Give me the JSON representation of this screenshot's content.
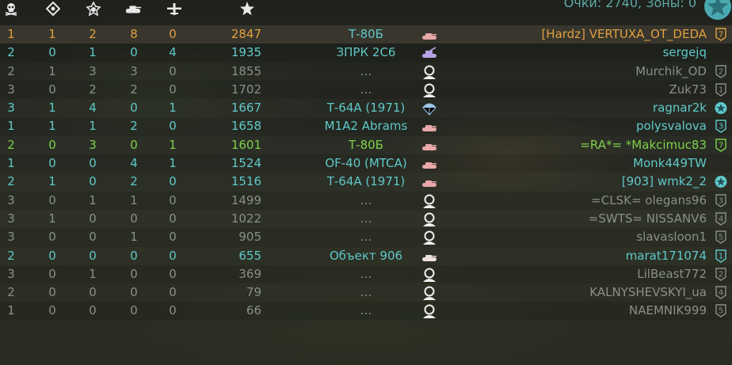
{
  "header": {
    "icons": [
      "skull-icon",
      "target-icon",
      "medal-icon",
      "tank-icon",
      "plane-icon",
      "star-icon"
    ],
    "score_text": "Очки: 2740, Зоны: 0"
  },
  "colors": {
    "teal": "#5fc9c9",
    "gray": "#8a8f88",
    "green": "#7ed04a",
    "orange": "#e0a040",
    "highlight_row": "#3c3a30"
  },
  "rows": [
    {
      "deaths": "1",
      "c2": "1",
      "c3": "2",
      "c4": "8",
      "c5": "0",
      "points": "2847",
      "vehicle": "Т-80Б",
      "vicon": "tank",
      "name": "[Hardz] VERTUXA_OT_DEDA",
      "rank": "7",
      "style": "orange",
      "highlight": true
    },
    {
      "deaths": "2",
      "c2": "0",
      "c3": "1",
      "c4": "0",
      "c5": "4",
      "points": "1935",
      "vehicle": "ЗПРК 2С6",
      "vicon": "spaa",
      "name": "sergejq",
      "rank": "",
      "style": "teal"
    },
    {
      "deaths": "2",
      "c2": "1",
      "c3": "3",
      "c4": "3",
      "c5": "0",
      "points": "1855",
      "vehicle": "...",
      "vicon": "dead",
      "name": "Murchik_OD",
      "rank": "2",
      "style": "gray"
    },
    {
      "deaths": "3",
      "c2": "0",
      "c3": "2",
      "c4": "2",
      "c5": "0",
      "points": "1702",
      "vehicle": "...",
      "vicon": "dead",
      "name": "Zuk73",
      "rank": "1",
      "style": "gray"
    },
    {
      "deaths": "3",
      "c2": "1",
      "c3": "4",
      "c4": "0",
      "c5": "1",
      "points": "1667",
      "vehicle": "Т-64А (1971)",
      "vicon": "parachute",
      "name": "ragnar2k",
      "rank": "star",
      "style": "teal"
    },
    {
      "deaths": "1",
      "c2": "1",
      "c3": "1",
      "c4": "2",
      "c5": "0",
      "points": "1658",
      "vehicle": "M1A2 Abrams",
      "vicon": "tank",
      "name": "polysvalova",
      "rank": "3",
      "style": "teal"
    },
    {
      "deaths": "2",
      "c2": "0",
      "c3": "3",
      "c4": "0",
      "c5": "1",
      "points": "1601",
      "vehicle": "Т-80Б",
      "vicon": "tank",
      "name": "=RA*= *Makcimuc83",
      "rank": "7",
      "style": "green"
    },
    {
      "deaths": "1",
      "c2": "0",
      "c3": "0",
      "c4": "4",
      "c5": "1",
      "points": "1524",
      "vehicle": "OF-40 (MTCA)",
      "vicon": "tank",
      "name": "Monk449TW",
      "rank": "",
      "style": "teal"
    },
    {
      "deaths": "2",
      "c2": "1",
      "c3": "0",
      "c4": "2",
      "c5": "0",
      "points": "1516",
      "vehicle": "Т-64А (1971)",
      "vicon": "tank",
      "name": "[903] wmk2_2",
      "rank": "star",
      "style": "teal"
    },
    {
      "deaths": "3",
      "c2": "0",
      "c3": "1",
      "c4": "1",
      "c5": "0",
      "points": "1499",
      "vehicle": "...",
      "vicon": "dead",
      "name": "=CLSK= olegans96",
      "rank": "3",
      "style": "gray"
    },
    {
      "deaths": "3",
      "c2": "1",
      "c3": "0",
      "c4": "0",
      "c5": "0",
      "points": "1022",
      "vehicle": "...",
      "vicon": "dead",
      "name": "=SWTS= NISSANV6",
      "rank": "4",
      "style": "gray"
    },
    {
      "deaths": "3",
      "c2": "0",
      "c3": "0",
      "c4": "1",
      "c5": "0",
      "points": "905",
      "vehicle": "...",
      "vicon": "dead",
      "name": "slavasloon1",
      "rank": "5",
      "style": "gray"
    },
    {
      "deaths": "2",
      "c2": "0",
      "c3": "0",
      "c4": "0",
      "c5": "0",
      "points": "655",
      "vehicle": "Объект 906",
      "vicon": "tank-light",
      "name": "marat171074",
      "rank": "1",
      "style": "teal"
    },
    {
      "deaths": "3",
      "c2": "0",
      "c3": "1",
      "c4": "0",
      "c5": "0",
      "points": "369",
      "vehicle": "...",
      "vicon": "dead",
      "name": "LilBeast772",
      "rank": "2",
      "style": "gray"
    },
    {
      "deaths": "2",
      "c2": "0",
      "c3": "0",
      "c4": "0",
      "c5": "0",
      "points": "79",
      "vehicle": "...",
      "vicon": "dead",
      "name": "KALNYSHEVSKYI_ua",
      "rank": "4",
      "style": "gray"
    },
    {
      "deaths": "1",
      "c2": "0",
      "c3": "0",
      "c4": "0",
      "c5": "0",
      "points": "66",
      "vehicle": "...",
      "vicon": "dead",
      "name": "NAEMNIK999",
      "rank": "5",
      "style": "gray"
    }
  ]
}
